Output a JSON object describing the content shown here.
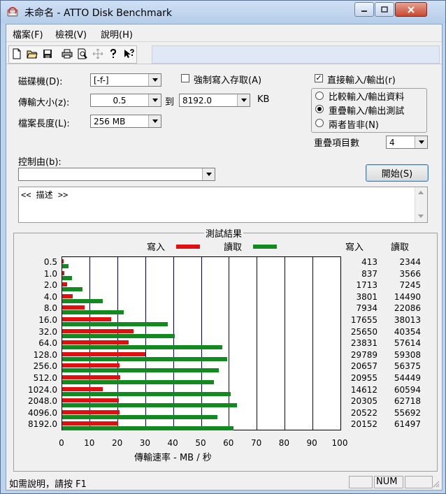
{
  "window": {
    "title": "未命名 - ATTO Disk Benchmark"
  },
  "menu": {
    "items": [
      "檔案(F)",
      "檢視(V)",
      "說明(H)"
    ]
  },
  "toolbar": {
    "icons": [
      "new-file-icon",
      "open-folder-icon",
      "save-icon",
      "print-icon",
      "print-preview-icon",
      "move-icon",
      "help-icon",
      "context-help-icon"
    ]
  },
  "form": {
    "drive_label": "磁碟機(D):",
    "drive_value": "[-f-]",
    "force_write_label": "強制寫入存取(A)",
    "force_write_checked": false,
    "transfer_label": "傳輸大小(z):",
    "transfer_from": "0.5",
    "to_label": "到",
    "transfer_to": "8192.0",
    "kb_label": "KB",
    "length_label": "檔案長度(L):",
    "length_value": "256 MB",
    "direct_io_label": "直接輸入/輸出(r)",
    "direct_io_checked": true,
    "radio_compare": "比較輸入/輸出資料",
    "radio_overlap": "重疊輸入/輸出測試",
    "radio_neither": "兩者皆非(N)",
    "radio_selected": "overlap",
    "queue_label": "重疊項目數",
    "queue_value": "4",
    "controlled_label": "控制由(b):",
    "controlled_value": "",
    "start_label": "開始(S)",
    "description": "<< 描述 >>"
  },
  "results": {
    "title": "測試結果",
    "legend_write": "寫入",
    "legend_read": "讀取",
    "col_write": "寫入",
    "col_read": "讀取",
    "xlabel": "傳輸速率 - MB / 秒",
    "colors": {
      "write": "#e01010",
      "read": "#118a20"
    }
  },
  "chart_data": {
    "type": "bar",
    "orientation": "horizontal",
    "title": "測試結果",
    "xlabel": "傳輸速率 - MB / 秒",
    "xlim": [
      0,
      100
    ],
    "xticks": [
      0,
      10,
      20,
      30,
      40,
      50,
      60,
      70,
      80,
      90,
      100
    ],
    "grid": true,
    "legend": "top",
    "categories": [
      "0.5",
      "1.0",
      "2.0",
      "4.0",
      "8.0",
      "16.0",
      "32.0",
      "64.0",
      "128.0",
      "256.0",
      "512.0",
      "1024.0",
      "2048.0",
      "4096.0",
      "8192.0"
    ],
    "series": [
      {
        "name": "寫入",
        "values": [
          413,
          837,
          1713,
          3801,
          7934,
          17655,
          25650,
          23831,
          29789,
          20657,
          20955,
          14612,
          20305,
          20522,
          20152
        ]
      },
      {
        "name": "讀取",
        "values": [
          2344,
          3566,
          7245,
          14490,
          22086,
          38013,
          40354,
          57614,
          59308,
          56375,
          54449,
          60594,
          62718,
          55692,
          61497
        ]
      }
    ]
  },
  "status": {
    "help_text": "如需說明，請按 F1",
    "num": "NUM"
  }
}
